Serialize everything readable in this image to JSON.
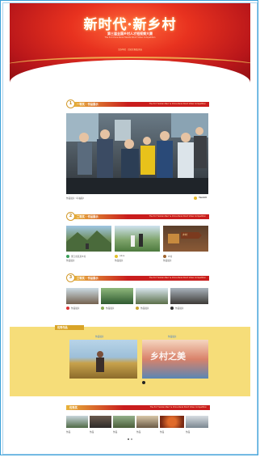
{
  "banner": {
    "title": "新时代·新乡村",
    "subtitle": "第三届全国乡村人才短视频大赛",
    "subtitle_en": "The 3rd China Rural Talents Short Video Competition",
    "note": "主办单位 · 活动主题及评选"
  },
  "sections": {
    "first_prize": {
      "medal": "1",
      "title": "一等奖 · 作品展示",
      "title_en": "The 3rd \"Golden Bee\" & China Rural Short Video Competition",
      "caption": "作品展示《幸福路》",
      "author": "Yandril"
    },
    "second_prize": {
      "medal": "2",
      "title": "二等奖 · 作品展示",
      "title_en": "The 3rd \"Golden Bee\" & China Rural Short Video Competition",
      "items": [
        {
          "caption": "作品展示",
          "author": "浙江省某某乡村"
        },
        {
          "caption": "作品展示",
          "author": "Alice"
        },
        {
          "caption": "作品展示",
          "author": "乡村"
        }
      ],
      "sign_text": "乡村"
    },
    "third_prize": {
      "medal": "3",
      "title": "三等奖 · 作品展示",
      "title_en": "The 3rd \"Golden Bee\" & China Rural Short Video Competition",
      "items": [
        {
          "caption": "作品展示"
        },
        {
          "caption": "作品展示"
        },
        {
          "caption": "作品展示"
        },
        {
          "caption": "作品展示"
        }
      ]
    },
    "featured": {
      "title": "优秀作品",
      "left_label": "作品展示",
      "right_label": "作品展示",
      "overlay_text": "乡村之美"
    },
    "excellent": {
      "title": "优秀奖",
      "title_en": "The 3rd \"Golden Bee\" & China Rural Short Video Competition",
      "items": [
        {
          "caption": "作品"
        },
        {
          "caption": "作品"
        },
        {
          "caption": "作品"
        },
        {
          "caption": "作品"
        },
        {
          "caption": "作品"
        },
        {
          "caption": "作品"
        }
      ]
    }
  },
  "colors": {
    "banner_red": "#c91d1d",
    "gold": "#d39b2c",
    "featured_bg": "#f6dd79",
    "frame_blue": "#3aa0d8"
  }
}
